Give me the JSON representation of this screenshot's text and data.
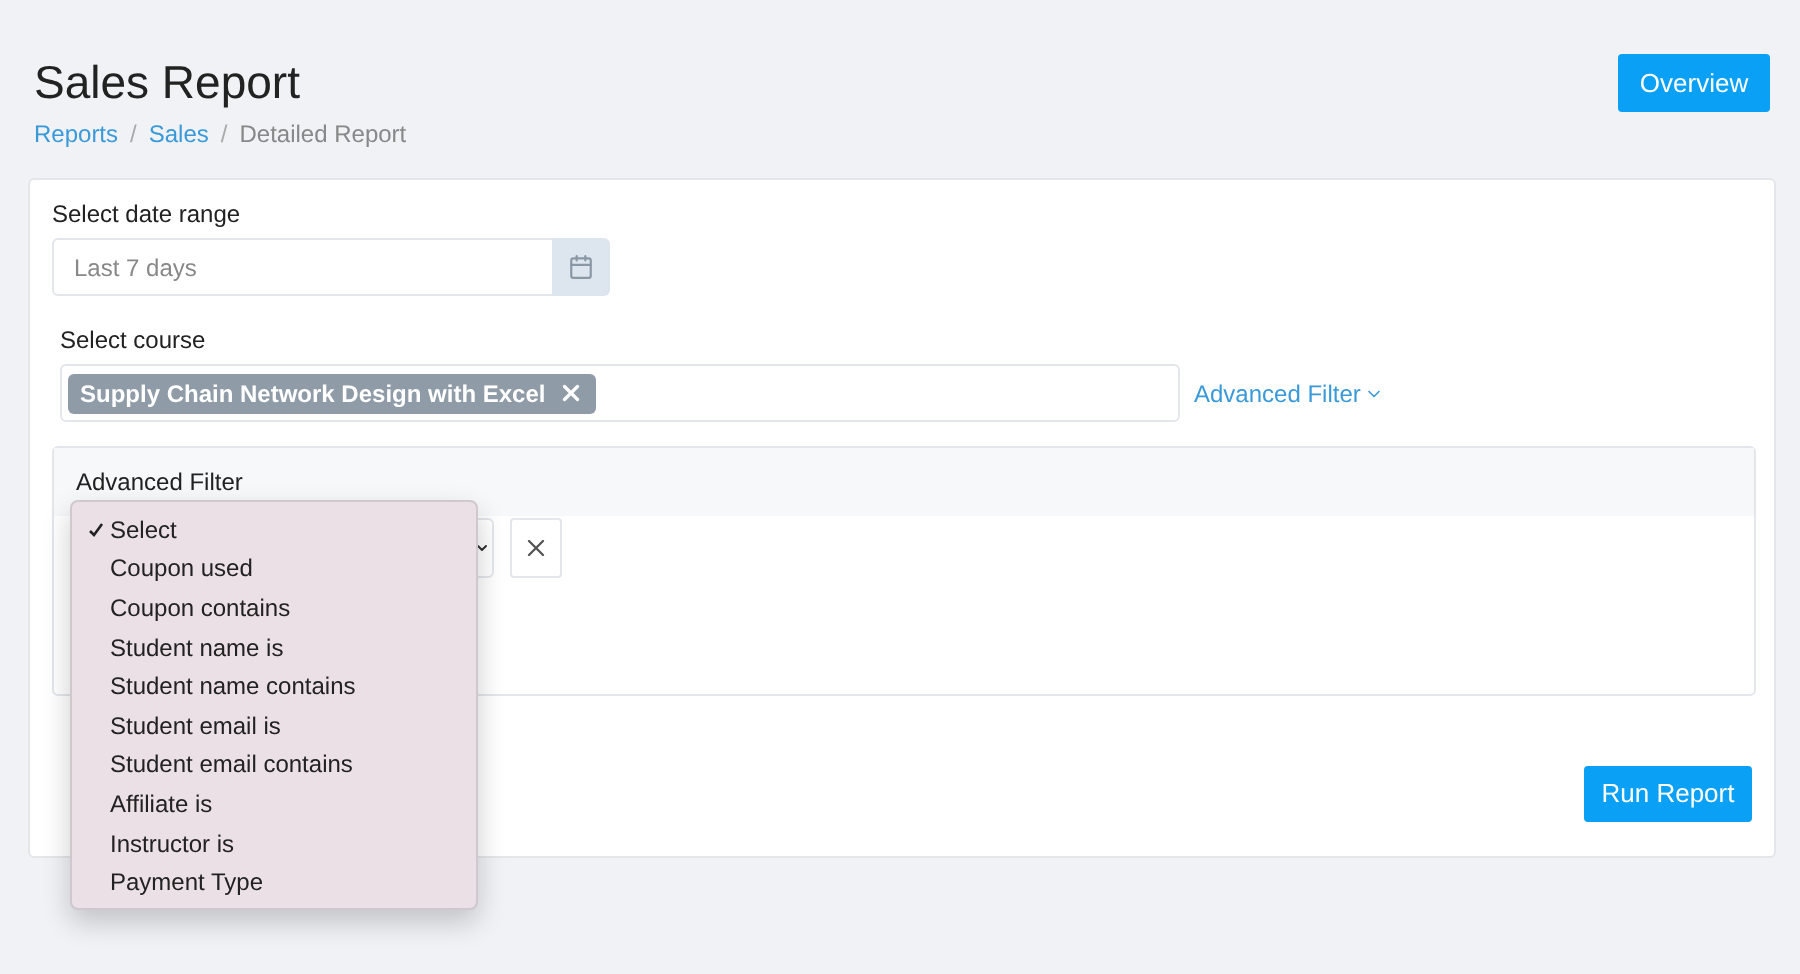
{
  "title": "Sales Report",
  "breadcrumb_separator": "/",
  "breadcrumb": [
    {
      "label": "Reports",
      "kind": "link"
    },
    {
      "label": "Sales",
      "kind": "link"
    },
    {
      "label": "Detailed Report",
      "kind": "current"
    }
  ],
  "overview_button": "Overview",
  "date_range": {
    "label": "Select date range",
    "placeholder": "Last 7 days"
  },
  "course": {
    "label": "Select course",
    "tags": [
      "Supply Chain Network Design with Excel"
    ]
  },
  "advanced_filter_link": "Advanced Filter",
  "advanced_filter": {
    "title": "Advanced Filter",
    "dropdown": [
      {
        "label": "Select",
        "selected": true
      },
      {
        "label": "Coupon used",
        "selected": false
      },
      {
        "label": "Coupon contains",
        "selected": false
      },
      {
        "label": "Student name is",
        "selected": false
      },
      {
        "label": "Student name contains",
        "selected": false
      },
      {
        "label": "Student email is",
        "selected": false
      },
      {
        "label": "Student email contains",
        "selected": false
      },
      {
        "label": "Affiliate is",
        "selected": false
      },
      {
        "label": "Instructor is",
        "selected": false
      },
      {
        "label": "Payment Type",
        "selected": false
      }
    ]
  },
  "run_button": "Run Report"
}
